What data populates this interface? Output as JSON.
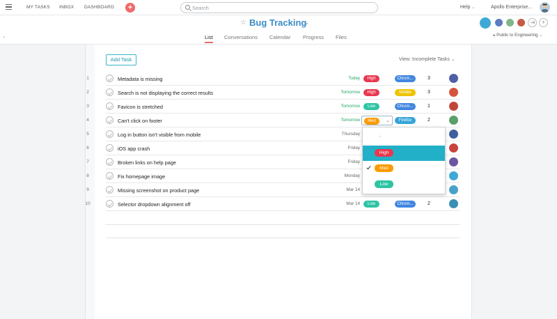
{
  "nav": {
    "my_tasks": "MY TASKS",
    "inbox": "INBOX",
    "dashboard": "DASHBOARD",
    "add_label": "+",
    "search_placeholder": "Search",
    "help": "Help",
    "organization": "Apollo Enterprise..."
  },
  "project": {
    "title": "Bug Tracking",
    "tabs": [
      "List",
      "Conversations",
      "Calendar",
      "Progress",
      "Files"
    ],
    "active_tab": "List",
    "visibility": "Public to Engineering",
    "add_member_label": "+"
  },
  "list": {
    "add_task_label": "Add Task",
    "view_label": "View: Incomplete Tasks",
    "tasks": [
      {
        "num": "1",
        "name": "Metadata is missing",
        "due": "Today",
        "due_color": "#27a564",
        "priority": "High",
        "platform": "Chrom...",
        "count": "3"
      },
      {
        "num": "2",
        "name": "Search is not displaying the correct results",
        "due": "Tomorrow",
        "due_color": "#27a564",
        "priority": "High",
        "platform": "Mobile",
        "count": "3"
      },
      {
        "num": "3",
        "name": "Favicon is stretched",
        "due": "Tomorrow",
        "due_color": "#27a564",
        "priority": "Low",
        "platform": "Chrom...",
        "count": "1"
      },
      {
        "num": "4",
        "name": "Can't click on footer",
        "due": "Tomorrow",
        "due_color": "#27a564",
        "priority": "Med",
        "platform": "Firefox",
        "count": "2"
      },
      {
        "num": "5",
        "name": "Log in button isn't visible from mobile",
        "due": "Thursday",
        "due_color": "#666666",
        "priority": "",
        "platform": "",
        "count": ""
      },
      {
        "num": "6",
        "name": "iOS app crash",
        "due": "Friday",
        "due_color": "#666666",
        "priority": "",
        "platform": "",
        "count": ""
      },
      {
        "num": "7",
        "name": "Broken links on help page",
        "due": "Friday",
        "due_color": "#666666",
        "priority": "",
        "platform": "",
        "count": ""
      },
      {
        "num": "8",
        "name": "Fix homepage image",
        "due": "Monday",
        "due_color": "#666666",
        "priority": "",
        "platform": "",
        "count": ""
      },
      {
        "num": "9",
        "name": "Missing screenshot on product page",
        "due": "Mar 14",
        "due_color": "#666666",
        "priority": "",
        "platform": "",
        "count": ""
      },
      {
        "num": "10",
        "name": "Selector dropdown alignment off",
        "due": "Mar 14",
        "due_color": "#666666",
        "priority": "Low",
        "platform": "Chrom...",
        "count": "2"
      }
    ]
  },
  "dropdown": {
    "empty_option": "-",
    "options": [
      "High",
      "Med",
      "Low"
    ],
    "highlighted": "High",
    "selected": "Med"
  },
  "colors": {
    "accent": "#3c8dc8",
    "high": "#e8384f",
    "med": "#fd9a00",
    "low": "#2ec4a5",
    "chrome": "#4186e0",
    "mobile": "#eec300",
    "firefox": "#37a5d8",
    "highlight": "#22b0c9"
  },
  "icons": {
    "menu": "hamburger-icon",
    "search": "search-icon",
    "star": "star-icon",
    "check": "checkmark-icon"
  }
}
